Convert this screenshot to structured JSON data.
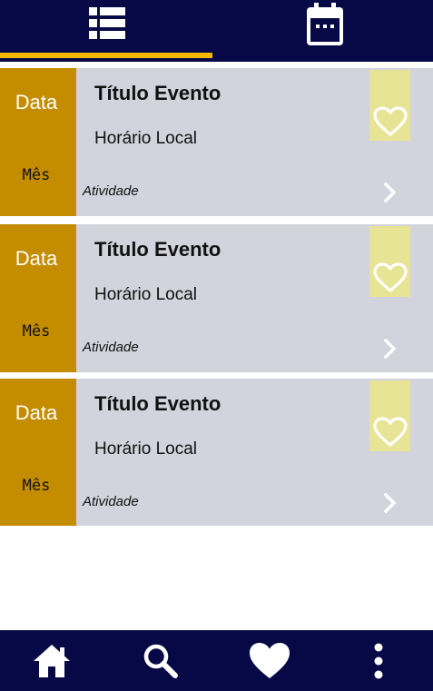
{
  "top_tabs": [
    {
      "name": "list-view",
      "icon": "list-icon",
      "active": true
    },
    {
      "name": "calendar-view",
      "icon": "calendar-icon",
      "active": false
    }
  ],
  "colors": {
    "bar": "#070947",
    "indicator": "#f5b800",
    "date_col": "#c48d00",
    "card": "#d2d3dc",
    "fav_box": "#e8e495"
  },
  "events": [
    {
      "day": "Data",
      "month": "Mês",
      "title": "Título Evento",
      "time": "Horário Local",
      "activity": "Atividade",
      "fav_icon": "heart-outline-icon",
      "action_icon": "chevron-right-icon"
    },
    {
      "day": "Data",
      "month": "Mês",
      "title": "Título Evento",
      "time": "Horário Local",
      "activity": "Atividade",
      "fav_icon": "heart-outline-icon",
      "action_icon": "chevron-right-icon"
    },
    {
      "day": "Data",
      "month": "Mês",
      "title": "Título Evento",
      "time": "Horário Local",
      "activity": "Atividade",
      "fav_icon": "heart-outline-icon",
      "action_icon": "chevron-right-icon"
    }
  ],
  "bottom_nav": [
    {
      "name": "home",
      "icon": "home-icon"
    },
    {
      "name": "search",
      "icon": "search-icon"
    },
    {
      "name": "favorites",
      "icon": "heart-icon"
    },
    {
      "name": "more",
      "icon": "more-vertical-icon"
    }
  ]
}
